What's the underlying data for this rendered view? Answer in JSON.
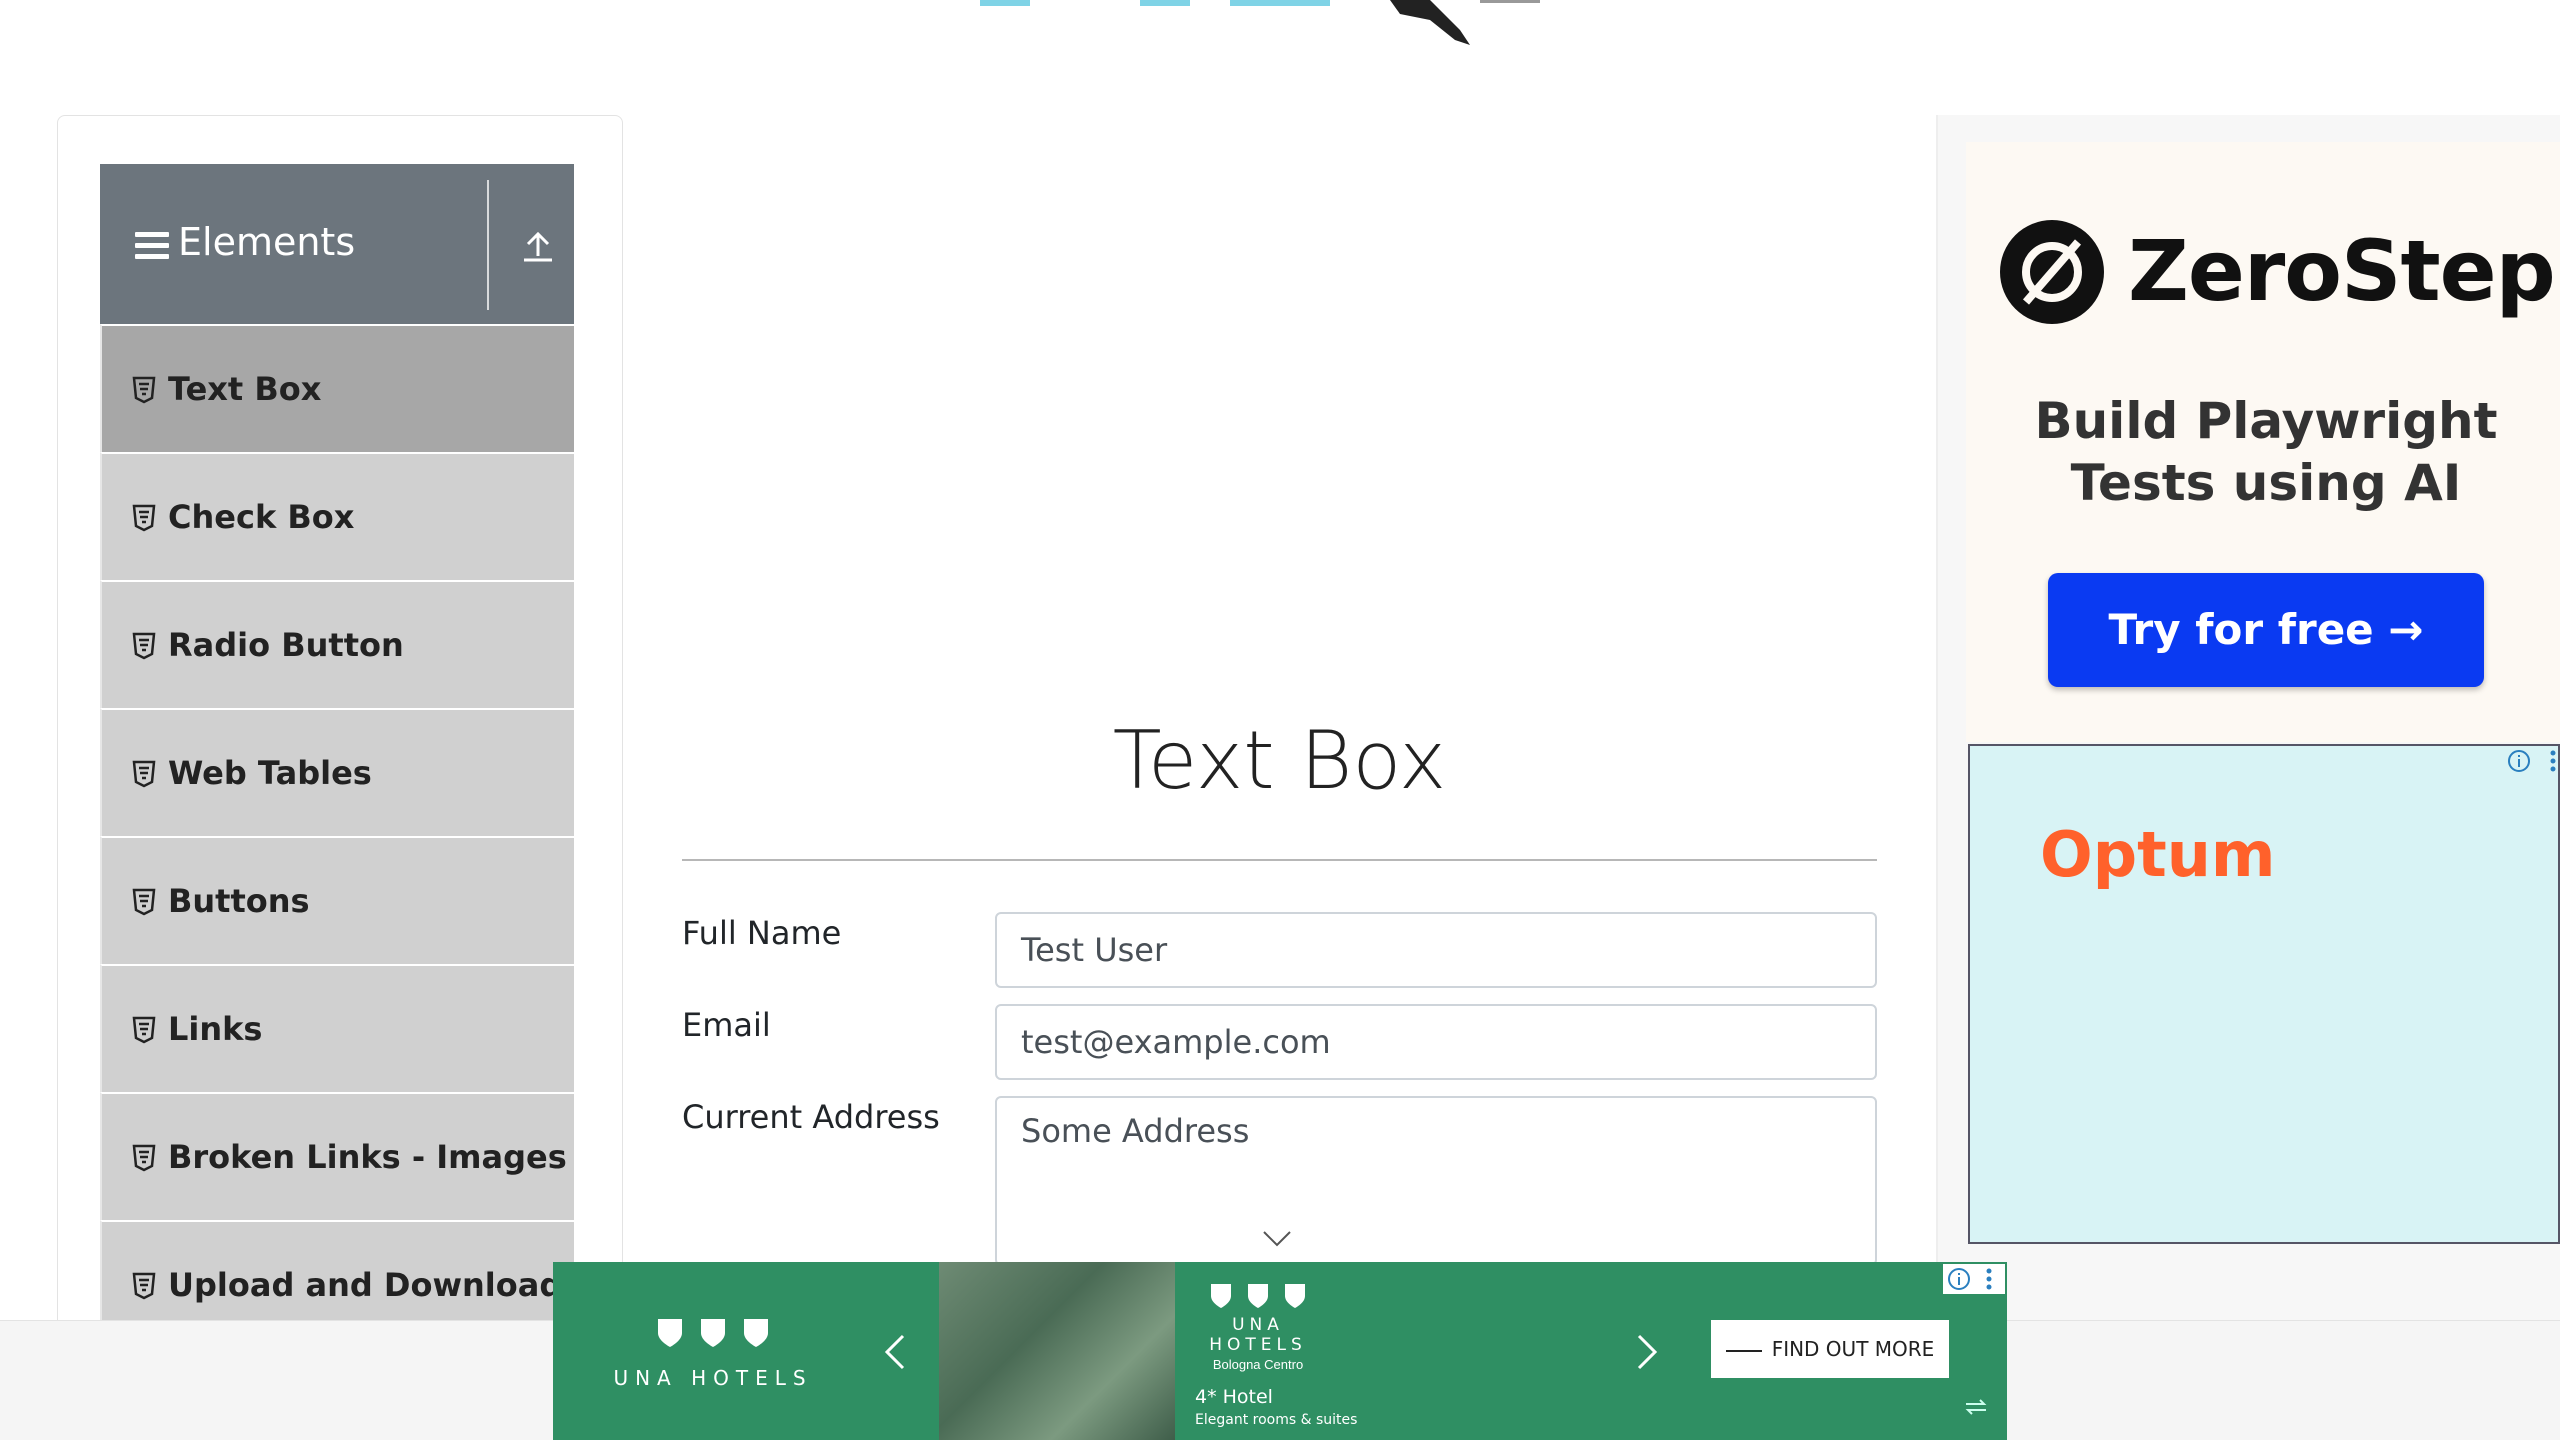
{
  "sidebar": {
    "group_title": "Elements",
    "items": [
      {
        "label": "Text Box",
        "active": true
      },
      {
        "label": "Check Box",
        "active": false
      },
      {
        "label": "Radio Button",
        "active": false
      },
      {
        "label": "Web Tables",
        "active": false
      },
      {
        "label": "Buttons",
        "active": false
      },
      {
        "label": "Links",
        "active": false
      },
      {
        "label": "Broken Links - Images",
        "active": false
      },
      {
        "label": "Upload and Download",
        "active": false
      }
    ],
    "item_icon": "html5-icon",
    "collapse_icon": "upload-arrow-icon"
  },
  "main": {
    "title": "Text Box",
    "form": {
      "full_name_label": "Full Name",
      "full_name_value": "Test User",
      "email_label": "Email",
      "email_value": "test@example.com",
      "address_label": "Current Address",
      "address_value": "Some Address"
    }
  },
  "ads": {
    "zerostep": {
      "brand": "ZeroStep",
      "tagline_1": "Build Playwright",
      "tagline_2": "Tests using AI",
      "cta": "Try for free →",
      "cta_color": "#0a3af2"
    },
    "optum": {
      "brand": "Optum",
      "brand_color": "#ff612b"
    },
    "una": {
      "brand": "UNA HOTELS",
      "mid_brand": "UNA HOTELS",
      "mid_city": "Bologna Centro",
      "hotel_stars": "4* Hotel",
      "hotel_desc": "Elegant rooms & suites",
      "cta": "FIND OUT MORE",
      "bg_color": "#2f8f63"
    }
  }
}
